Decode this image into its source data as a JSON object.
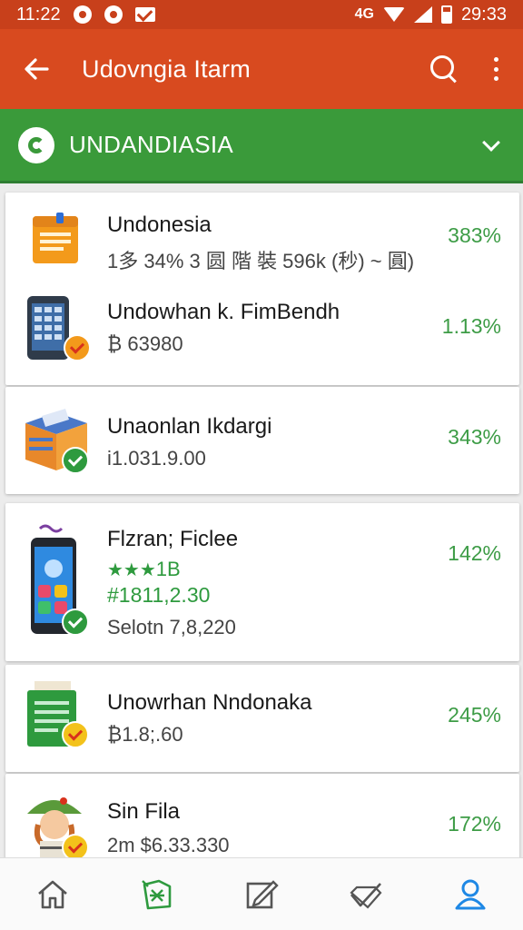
{
  "status_bar": {
    "time_left": "11:22",
    "time_right": "29:33",
    "network": "4G",
    "icons": [
      "notification-icon",
      "record-icon",
      "mail-icon",
      "wifi-icon",
      "signal-icon",
      "battery-icon"
    ]
  },
  "app_bar": {
    "title": "Udovngia Itarm",
    "icons": [
      "back-arrow-icon",
      "search-icon",
      "more-vert-icon"
    ]
  },
  "section_header": {
    "title": "UNDANDIASIA",
    "icons": [
      "section-logo-icon",
      "chevron-down-icon"
    ]
  },
  "items": [
    {
      "name": "Undonesia",
      "sub": "1多 34% 3 圆 階 裝 596k (秒) ~ 圓)",
      "percent": "383%",
      "icon": "notepad-icon"
    },
    {
      "name": "Undowhan k. FimBendh",
      "sub": "₿ 63980",
      "percent": "1.13%",
      "icon": "calculator-phone-icon"
    },
    {
      "name": "Unaonlan Ikdargi",
      "sub": "i1.031.9.00",
      "percent": "343%",
      "icon": "box-icon"
    },
    {
      "name": "Flzran; Ficlee",
      "rating": "★★★",
      "rating_label": "1B",
      "price": "#1811,2.30",
      "sub": "Selotn 7,8,220",
      "percent": "142%",
      "icon": "smartphone-icon"
    },
    {
      "name": "Unowrhan Nndonaka",
      "sub": "₿1.8;.60",
      "percent": "245%",
      "icon": "document-icon"
    },
    {
      "name": "Sin Fila",
      "sub": "2m $6.33.330",
      "percent": "172%",
      "icon": "avatar-icon"
    }
  ],
  "bottom_nav": {
    "items": [
      "home-icon",
      "store-icon",
      "edit-icon",
      "deals-icon",
      "profile-icon"
    ],
    "active": "profile-icon"
  },
  "colors": {
    "status_bar": "#c8401b",
    "app_bar": "#d84a1f",
    "section_bar": "#3a9a3a",
    "percent_green": "#3d9c46",
    "nav_active": "#1e88e5"
  }
}
